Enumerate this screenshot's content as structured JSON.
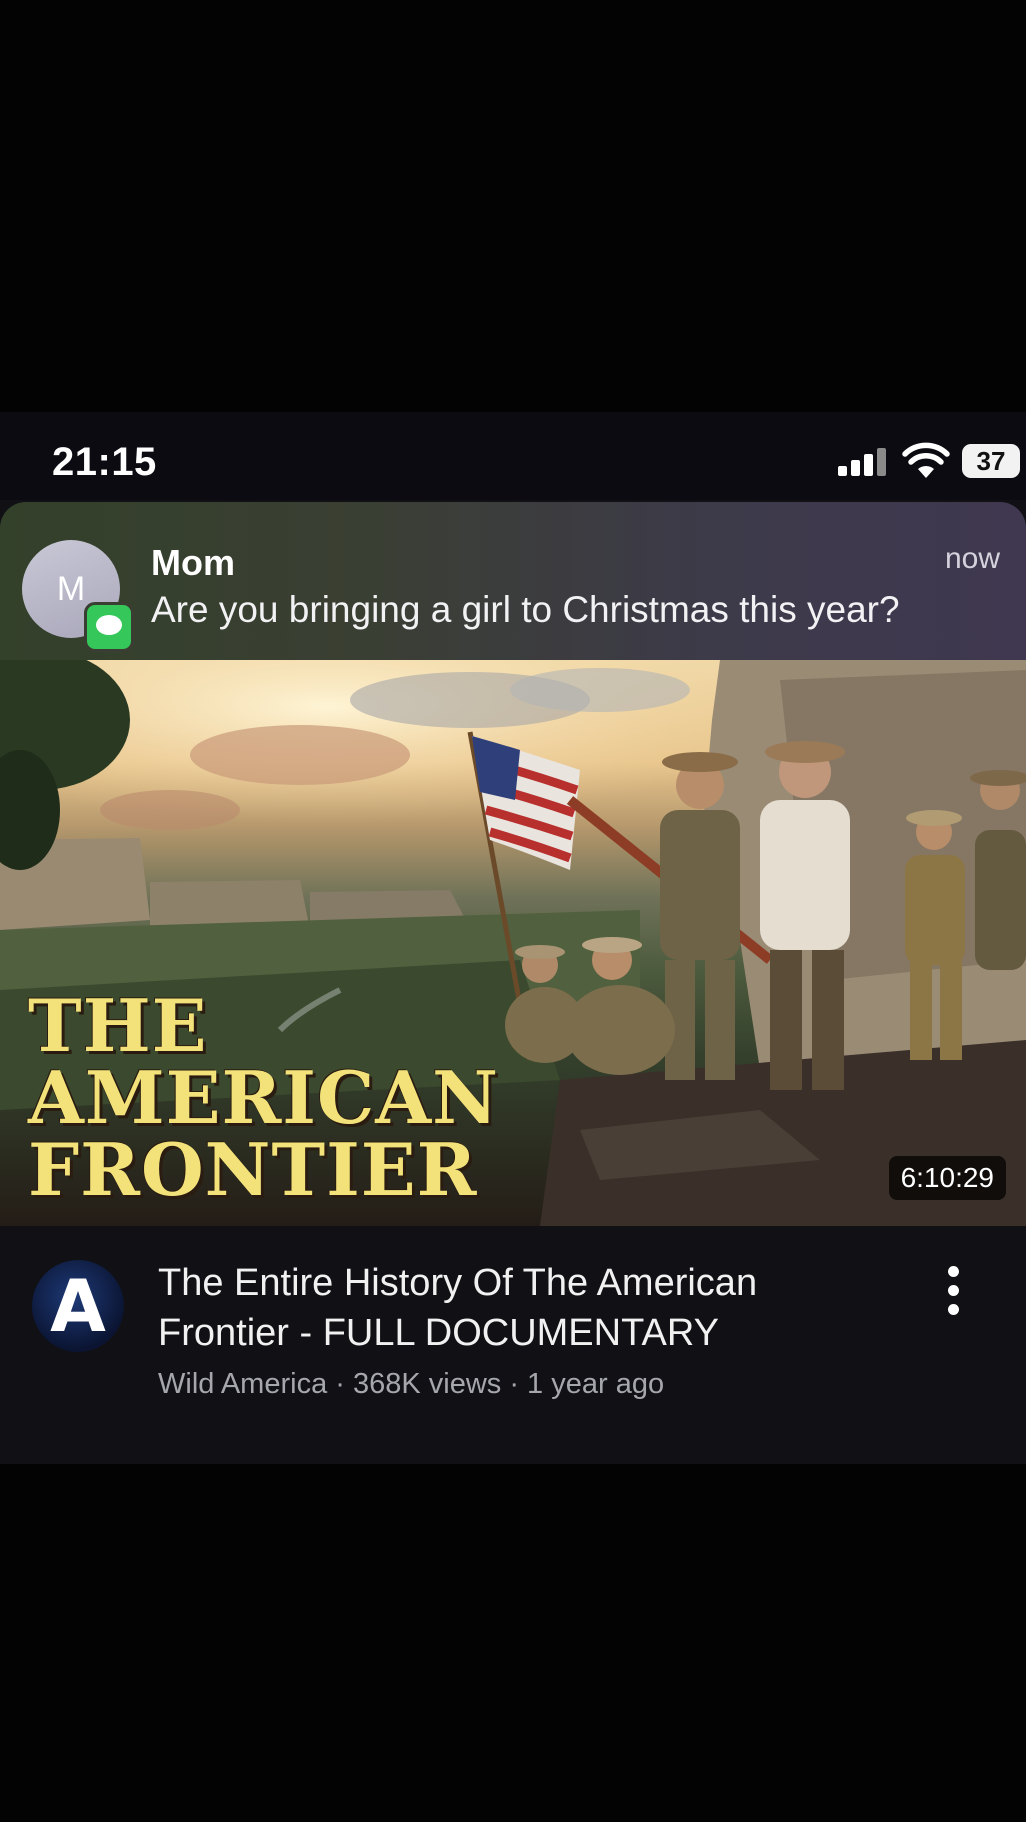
{
  "status_bar": {
    "time": "21:15",
    "battery": "37",
    "icons": [
      "signal-icon",
      "wifi-icon",
      "battery-icon"
    ]
  },
  "notification": {
    "avatar_letter": "M",
    "sender": "Mom",
    "time": "now",
    "message": "Are you bringing a girl to Christmas this year?",
    "app_icon": "messages-icon"
  },
  "thumbnail": {
    "title_lines": [
      "THE",
      "AMERICAN",
      "FRONTIER"
    ],
    "duration": "6:10:29"
  },
  "video": {
    "channel_avatar_letter": "A",
    "title": "The Entire History Of The American Frontier - FULL DOCUMENTARY",
    "meta": "Wild America · 368K views · 1 year ago"
  }
}
